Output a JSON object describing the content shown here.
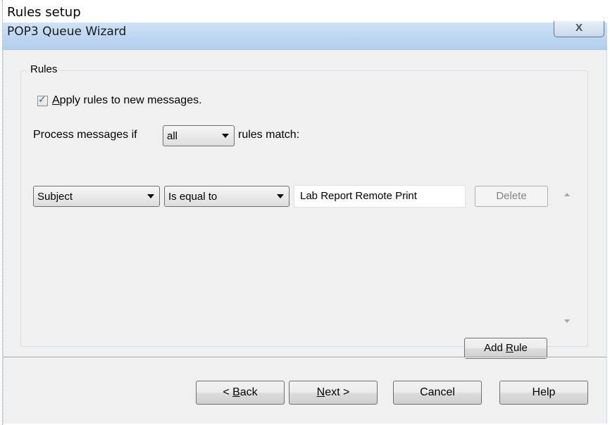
{
  "caption": "Rules setup",
  "window": {
    "title": "POP3 Queue Wizard",
    "close_glyph": "X"
  },
  "rules": {
    "group_label": "Rules",
    "apply_checked": true,
    "apply_label_accel": "A",
    "apply_label_rest": "pply rules to new messages.",
    "process_prefix": "Process messages if",
    "match_mode": "all",
    "process_suffix": "rules match:",
    "rule_items": [
      {
        "field": "Subject",
        "operator": "Is equal to",
        "value": "Lab Report Remote Print",
        "delete_label": "Delete"
      }
    ],
    "add_rule_label_prefix": "Add ",
    "add_rule_label_accel": "R",
    "add_rule_label_rest": "ule"
  },
  "footer": {
    "back_prefix": "< ",
    "back_accel": "B",
    "back_rest": "ack",
    "next_accel": "N",
    "next_rest": "ext >",
    "cancel_label": "Cancel",
    "help_label": "Help"
  },
  "icons": {
    "checkbox": "check-icon",
    "combo_arrow": "chevron-down-icon",
    "scroll_up": "scroll-up-icon",
    "scroll_down": "scroll-down-icon",
    "close": "close-icon"
  }
}
